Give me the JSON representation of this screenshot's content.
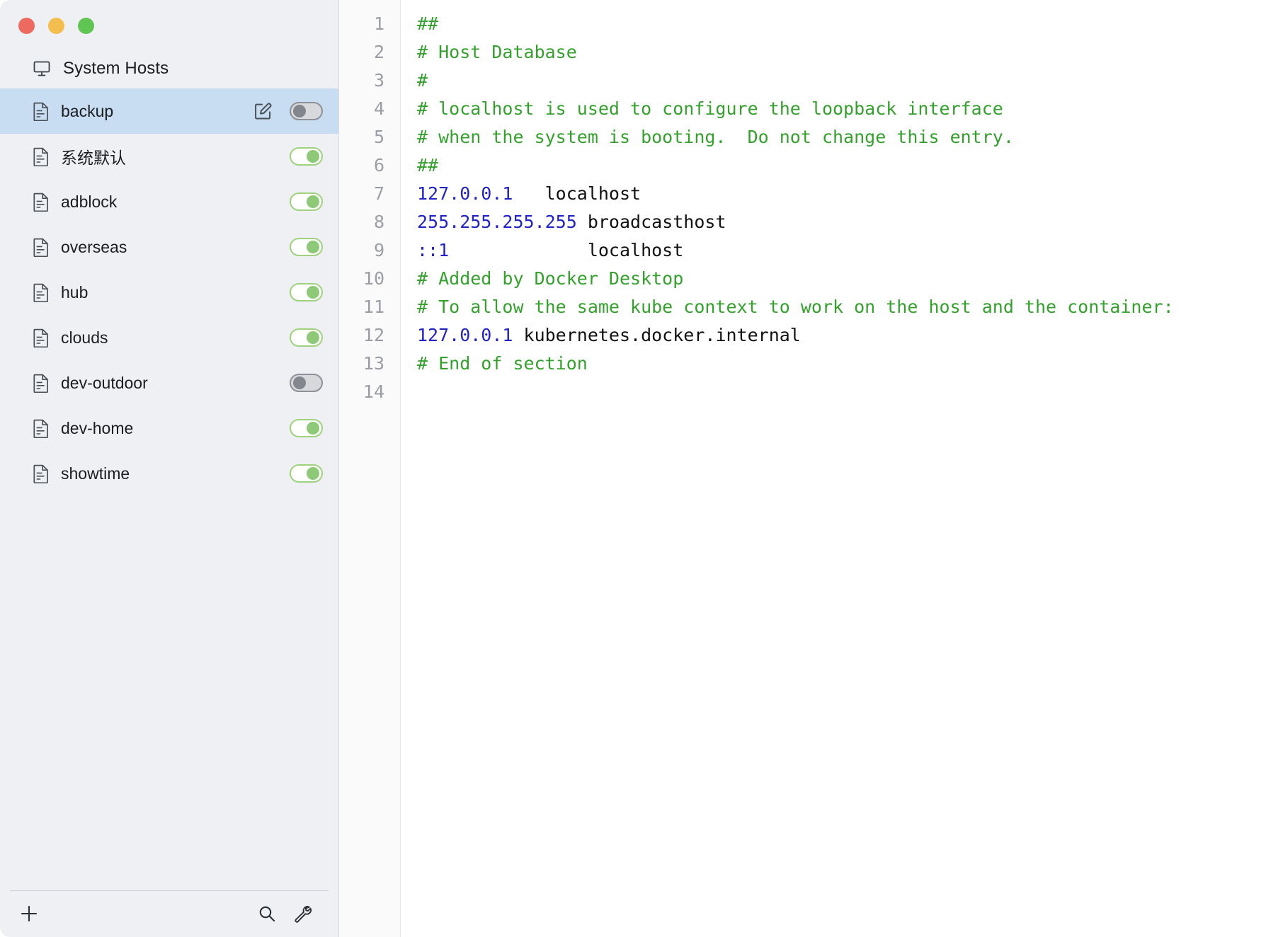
{
  "window": {
    "traffic_lights": [
      "close",
      "minimize",
      "maximize"
    ],
    "colors": {
      "close": "#ec6a5f",
      "minimize": "#f4bd50",
      "maximize": "#61c554",
      "sidebar_bg": "#eef0f4",
      "selected_row": "#c8ddf2",
      "toggle_on": "#8ec977",
      "toggle_off": "#83868c",
      "comment_green": "#35a02e",
      "ip_blue": "#2323c4"
    }
  },
  "sidebar": {
    "system_hosts": {
      "label": "System Hosts",
      "icon": "monitor-icon"
    },
    "items": [
      {
        "name": "backup",
        "enabled": false,
        "selected": true,
        "has_edit": true
      },
      {
        "name": "系统默认",
        "enabled": true,
        "selected": false,
        "has_edit": false
      },
      {
        "name": "adblock",
        "enabled": true,
        "selected": false,
        "has_edit": false
      },
      {
        "name": "overseas",
        "enabled": true,
        "selected": false,
        "has_edit": false
      },
      {
        "name": "hub",
        "enabled": true,
        "selected": false,
        "has_edit": false
      },
      {
        "name": "clouds",
        "enabled": true,
        "selected": false,
        "has_edit": false
      },
      {
        "name": "dev-outdoor",
        "enabled": false,
        "selected": false,
        "has_edit": false
      },
      {
        "name": "dev-home",
        "enabled": true,
        "selected": false,
        "has_edit": false
      },
      {
        "name": "showtime",
        "enabled": true,
        "selected": false,
        "has_edit": false
      }
    ],
    "footer": {
      "add": "add-icon",
      "search": "search-icon",
      "wrench": "wrench-icon"
    }
  },
  "editor": {
    "lines": [
      {
        "num": "1",
        "segments": [
          {
            "text": "##",
            "type": "comment"
          }
        ]
      },
      {
        "num": "2",
        "segments": [
          {
            "text": "# Host Database",
            "type": "comment"
          }
        ]
      },
      {
        "num": "3",
        "segments": [
          {
            "text": "#",
            "type": "comment"
          }
        ]
      },
      {
        "num": "4",
        "segments": [
          {
            "text": "# localhost is used to configure the loopback interface",
            "type": "comment"
          }
        ]
      },
      {
        "num": "5",
        "segments": [
          {
            "text": "# when the system is booting.  Do not change this entry.",
            "type": "comment"
          }
        ]
      },
      {
        "num": "6",
        "segments": [
          {
            "text": "##",
            "type": "comment"
          }
        ]
      },
      {
        "num": "7",
        "segments": [
          {
            "text": "127.0.0.1",
            "type": "ip"
          },
          {
            "text": "   localhost",
            "type": "host"
          }
        ]
      },
      {
        "num": "8",
        "segments": [
          {
            "text": "255.255.255.255",
            "type": "ip"
          },
          {
            "text": " broadcasthost",
            "type": "host"
          }
        ]
      },
      {
        "num": "9",
        "segments": [
          {
            "text": "::1",
            "type": "ip"
          },
          {
            "text": "             localhost",
            "type": "host"
          }
        ]
      },
      {
        "num": "10",
        "segments": [
          {
            "text": "# Added by Docker Desktop",
            "type": "comment"
          }
        ]
      },
      {
        "num": "11",
        "segments": [
          {
            "text": "# To allow the same kube context to work on the host and the container:",
            "type": "comment"
          }
        ]
      },
      {
        "num": "12",
        "segments": [
          {
            "text": "127.0.0.1",
            "type": "ip"
          },
          {
            "text": " kubernetes.docker.internal",
            "type": "host"
          }
        ]
      },
      {
        "num": "13",
        "segments": [
          {
            "text": "# End of section",
            "type": "comment"
          }
        ]
      },
      {
        "num": "14",
        "segments": [
          {
            "text": "",
            "type": "host"
          }
        ]
      }
    ]
  }
}
